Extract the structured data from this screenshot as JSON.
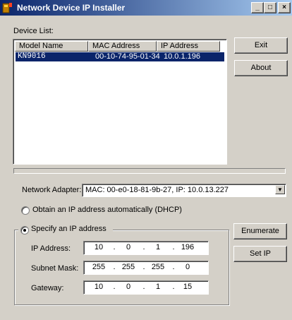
{
  "window": {
    "title": "Network Device IP Installer",
    "icon": "app-icon",
    "controls": {
      "minimize": "_",
      "maximize": "□",
      "close": "×"
    }
  },
  "device_list": {
    "label": "Device List:",
    "columns": [
      "Model Name",
      "MAC Address",
      "IP Address"
    ],
    "rows": [
      {
        "model": "KN9016",
        "mac": "00-10-74-95-01-34",
        "ip": "10.0.1.196",
        "selected": true
      }
    ]
  },
  "buttons": {
    "exit": "Exit",
    "about": "About",
    "enumerate": "Enumerate",
    "set_ip": "Set IP"
  },
  "progress": {
    "value": 0
  },
  "network_adapter": {
    "label": "Network Adapter:",
    "selected": "MAC: 00-e0-18-81-9b-27,  IP: 10.0.13.227",
    "dropdown_icon": "chevron-down-icon"
  },
  "dhcp_option": {
    "label": "Obtain an IP address automatically (DHCP)",
    "checked": false
  },
  "static_option": {
    "label": "Specify an IP address",
    "checked": true
  },
  "ip_fields": {
    "ip": {
      "label": "IP Address:",
      "octets": [
        "10",
        "0",
        "1",
        "196"
      ]
    },
    "subnet": {
      "label": "Subnet Mask:",
      "octets": [
        "255",
        "255",
        "255",
        "0"
      ]
    },
    "gateway": {
      "label": "Gateway:",
      "octets": [
        "10",
        "0",
        "1",
        "15"
      ]
    }
  },
  "colors": {
    "selection": "#0a246a",
    "face": "#d4d0c8",
    "title_start": "#0a246a",
    "title_end": "#a6caf0"
  }
}
